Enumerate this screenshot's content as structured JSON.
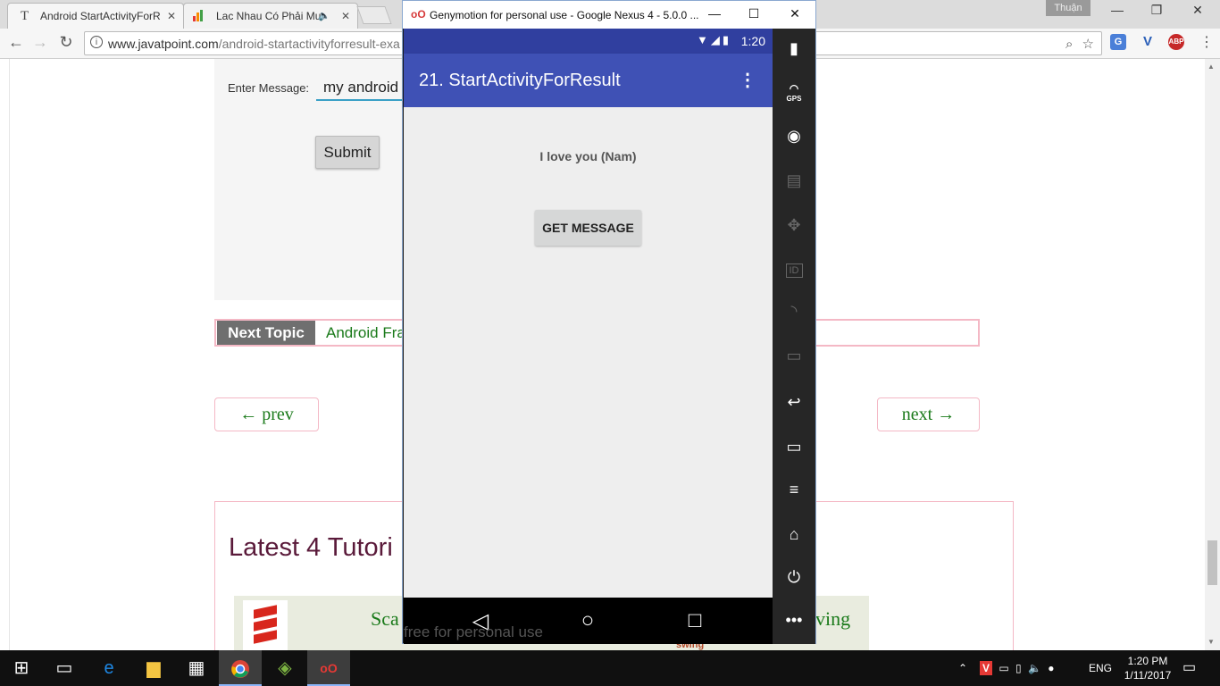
{
  "browser": {
    "tabs": [
      {
        "label": "Android StartActivityForR",
        "active": true,
        "favicon": "T"
      },
      {
        "label": "Lac Nhau Có Phải Mu",
        "active": false
      }
    ],
    "profile_name": "Thuận",
    "url_domain": "www.javatpoint.com",
    "url_path": "/android-startactivityforresult-exa",
    "extensions": [
      "google-translate",
      "vivaldi-v",
      "adblock-plus"
    ]
  },
  "page": {
    "enter_message_label": "Enter Message:",
    "enter_message_value": "my android",
    "submit_label": "Submit",
    "next_topic_label": "Next Topic",
    "next_topic_value": "Android Fra",
    "prev_label": "← prev",
    "next_label": "next →",
    "tutorials_title": "Latest 4 Tutori",
    "tutorial_left_text": "Sca",
    "tutorial_right_text": "ving",
    "tutorial_partial": "swing"
  },
  "genymotion": {
    "window_title": "Genymotion for personal use - Google Nexus 4 - 5.0.0 ...",
    "status_clock": "1:20",
    "app_title": "21. StartActivityForResult",
    "result_message": "I love you (Nam)",
    "get_message_label": "GET MESSAGE",
    "watermark": "free for personal use",
    "side_panel": [
      "battery",
      "GPS",
      "camera",
      "capture",
      "dpad",
      "ID",
      "network",
      "sms",
      "back",
      "recent",
      "menu",
      "home",
      "power",
      "more"
    ]
  },
  "taskbar": {
    "time": "1:20 PM",
    "date": "1/11/2017",
    "language": "ENG"
  }
}
